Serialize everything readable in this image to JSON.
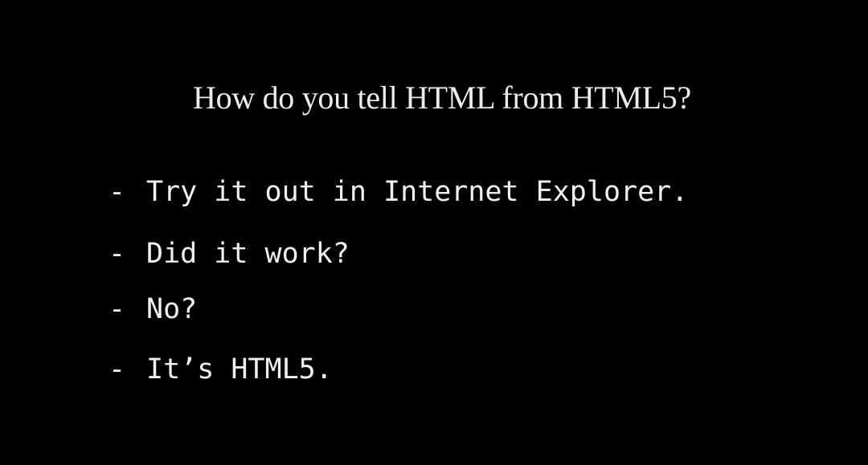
{
  "slide": {
    "title": "How do you tell HTML from HTML5?",
    "bullet_marker": "-",
    "lines": [
      "Try it out in Internet Explorer.",
      "Did it work?",
      "No?",
      "It’s HTML5."
    ]
  },
  "colors": {
    "background": "#000000",
    "text": "#f0f0f0"
  }
}
